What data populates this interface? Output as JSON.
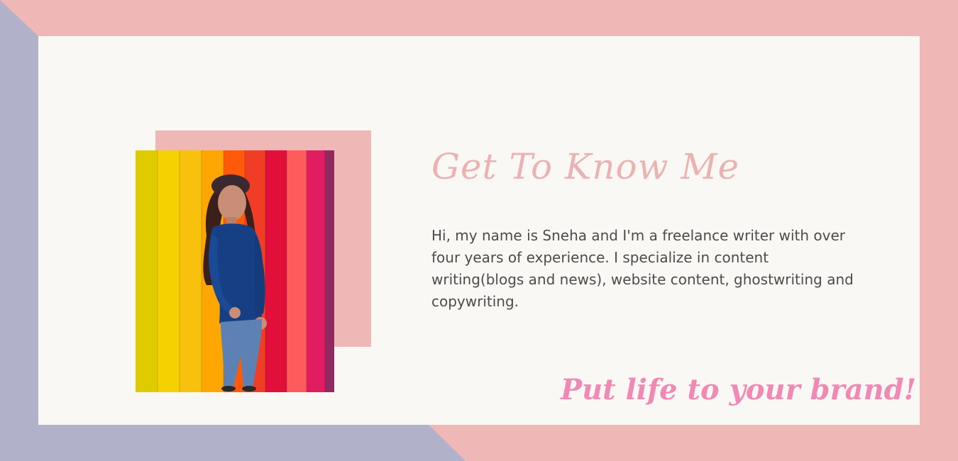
{
  "colors": {
    "background_pink": "#efb7b6",
    "background_lavender": "#b1b1c9",
    "card": "#f9f8f4",
    "heading": "#eab3b1",
    "body_text": "#4d4b4b",
    "tagline": "#f189b5"
  },
  "about": {
    "heading": "Get To Know Me",
    "bio": "Hi, my name is Sneha and I'm a freelance writer with over four years of experience. I specialize in content writing(blogs and news), website content, ghostwriting and copywriting.",
    "tagline": "Put life to your brand!"
  }
}
